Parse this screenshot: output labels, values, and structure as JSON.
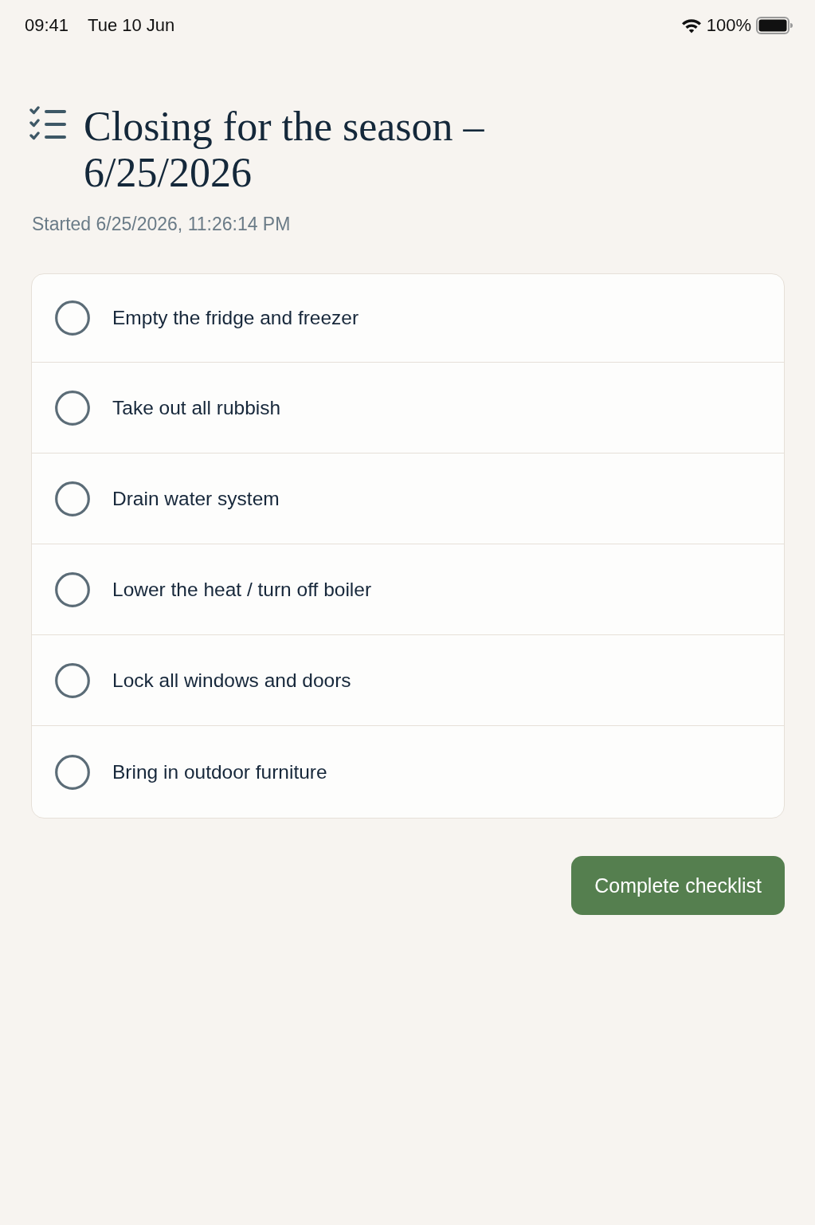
{
  "status_bar": {
    "time": "09:41",
    "date": "Tue 10 Jun",
    "battery": "100%"
  },
  "header": {
    "title": "Closing for the season – 6/25/2026",
    "subtitle": "Started 6/25/2026, 11:26:14 PM"
  },
  "checklist": {
    "items": [
      {
        "label": "Empty the fridge and freezer",
        "checked": false
      },
      {
        "label": "Take out all rubbish",
        "checked": false
      },
      {
        "label": "Drain water system",
        "checked": false
      },
      {
        "label": "Lower the heat / turn off boiler",
        "checked": false
      },
      {
        "label": "Lock all windows and doors",
        "checked": false
      },
      {
        "label": "Bring in outdoor furniture",
        "checked": false
      }
    ]
  },
  "actions": {
    "primary": "Complete checklist"
  }
}
